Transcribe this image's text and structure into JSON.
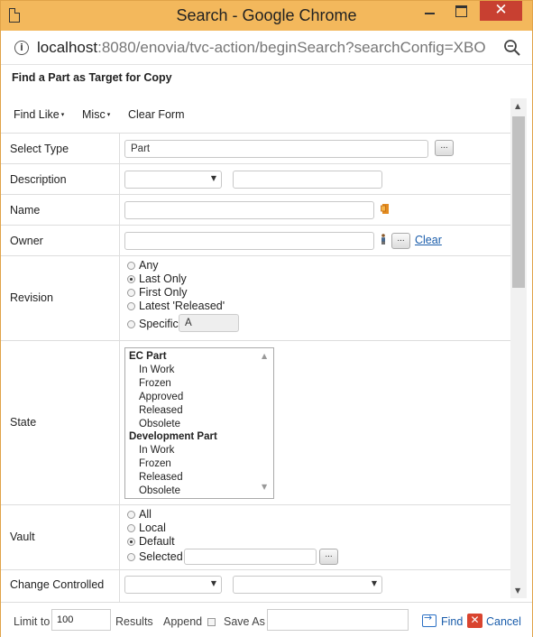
{
  "window": {
    "title": "Search - Google Chrome",
    "close_glyph": "✕"
  },
  "address": {
    "host": "localhost",
    "path": ":8080/enovia/tvc-action/beginSearch?searchConfig=XBO",
    "info_glyph": "i"
  },
  "page": {
    "heading": "Find a Part as Target for Copy"
  },
  "toolbar": {
    "find_like": "Find Like",
    "misc": "Misc",
    "clear_form": "Clear Form",
    "caret": "▾"
  },
  "form": {
    "select_type": {
      "label": "Select Type",
      "value": "Part",
      "button": "..."
    },
    "description": {
      "label": "Description",
      "operator": "",
      "value": ""
    },
    "name": {
      "label": "Name",
      "value": ""
    },
    "owner": {
      "label": "Owner",
      "value": "",
      "button": "...",
      "clear": "Clear"
    },
    "revision": {
      "label": "Revision",
      "options": [
        "Any",
        "Last Only",
        "First Only",
        "Latest 'Released'",
        "Specific"
      ],
      "selected": "Last Only",
      "specific_value": "A"
    },
    "state": {
      "label": "State",
      "groups": [
        {
          "name": "EC Part",
          "options": [
            "In Work",
            "Frozen",
            "Approved",
            "Released",
            "Obsolete"
          ]
        },
        {
          "name": "Development Part",
          "options": [
            "In Work",
            "Frozen",
            "Released",
            "Obsolete"
          ]
        }
      ]
    },
    "vault": {
      "label": "Vault",
      "options": [
        "All",
        "Local",
        "Default",
        "Selected"
      ],
      "selected": "Default",
      "selected_value": "",
      "button": "..."
    },
    "change_controlled": {
      "label": "Change Controlled",
      "value1": "",
      "value2": ""
    }
  },
  "footer": {
    "limit_label": "Limit to",
    "limit_value": "100",
    "results_label": "Results",
    "append_label": "Append",
    "save_as_label": "Save As",
    "save_as_value": "",
    "find_label": "Find",
    "cancel_label": "Cancel"
  },
  "colors": {
    "titlebar": "#f3b85c",
    "close_button": "#c84031",
    "link": "#1a5dab"
  }
}
